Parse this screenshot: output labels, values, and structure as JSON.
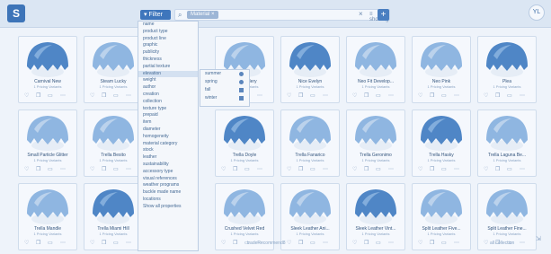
{
  "app": {
    "logo": "S"
  },
  "toolbar": {
    "filter_label": "▾ Filter",
    "search_chip": "Material ×",
    "clear_icon": "×",
    "sort_label": "≡ shorting",
    "add_label": "+",
    "avatar_label": "YL"
  },
  "dropdown": {
    "items": [
      "name",
      "product type",
      "product line",
      "graphic",
      "publicity",
      "thickness",
      "partial texture",
      "elevation",
      "weight",
      "author",
      "creation",
      "collection",
      "texture type",
      "prepaid",
      "item",
      "diameter",
      "homogeneity",
      "material category",
      "stock",
      "leather",
      "sustainability",
      "accessory type",
      "visual references",
      "weather programs",
      "buckle made name",
      "locations",
      "Show all properties"
    ],
    "highlight_index": 7
  },
  "submenu": {
    "items": [
      {
        "label": "summer",
        "marker": "dot"
      },
      {
        "label": "spring",
        "marker": "dot"
      },
      {
        "label": "fall",
        "marker": "sq"
      },
      {
        "label": "winter",
        "marker": "sq"
      }
    ]
  },
  "cards": [
    {
      "name": "Carnival New",
      "sub": "1 Pricing Variants"
    },
    {
      "name": "Steam Lucky",
      "sub": "1 Pricing Variants"
    },
    {
      "name": "Nice Gallery",
      "sub": "1 Pricing Variants"
    },
    {
      "name": "Nice Evelyn",
      "sub": "1 Pricing Variants"
    },
    {
      "name": "Neo Fit Develop...",
      "sub": "1 Pricing Variants"
    },
    {
      "name": "Neo Pink",
      "sub": "1 Pricing Variants"
    },
    {
      "name": "Plea",
      "sub": "1 Pricing Variants"
    },
    {
      "name": "Small Particle Glitter",
      "sub": "1 Pricing Variants"
    },
    {
      "name": "Trella Besito",
      "sub": "1 Pricing Variants"
    },
    {
      "name": "Trella Doyle",
      "sub": "1 Pricing Variants"
    },
    {
      "name": "Trella Fanarico",
      "sub": "1 Pricing Variants"
    },
    {
      "name": "Trella Geronimo",
      "sub": "1 Pricing Variants"
    },
    {
      "name": "Trella Hasky",
      "sub": "1 Pricing Variants"
    },
    {
      "name": "Trella Laguna Be...",
      "sub": "1 Pricing Variants"
    },
    {
      "name": "Trella Mandle",
      "sub": "1 Pricing Variants"
    },
    {
      "name": "Trella Miami Hill",
      "sub": "1 Pricing Variants"
    },
    {
      "name": "Crushed Velvet Red",
      "sub": "1 Pricing Variants"
    },
    {
      "name": "Sleek Leather Ani...",
      "sub": "1 Pricing Variants"
    },
    {
      "name": "Sleek Leather Vint...",
      "sub": "1 Pricing Variants"
    },
    {
      "name": "Split Leather Five...",
      "sub": "1 Pricing Variants"
    },
    {
      "name": "Split Leather Fine...",
      "sub": "1 Pricing Variants"
    }
  ],
  "bottom": {
    "center_text": "tradeRecommend8",
    "right_text": "all collection"
  },
  "colors": {
    "accent": "#3e76bc",
    "topbar": "#dbe6f3",
    "fabric_dark": "#4f86c6",
    "fabric_light": "#8fb6e1"
  }
}
